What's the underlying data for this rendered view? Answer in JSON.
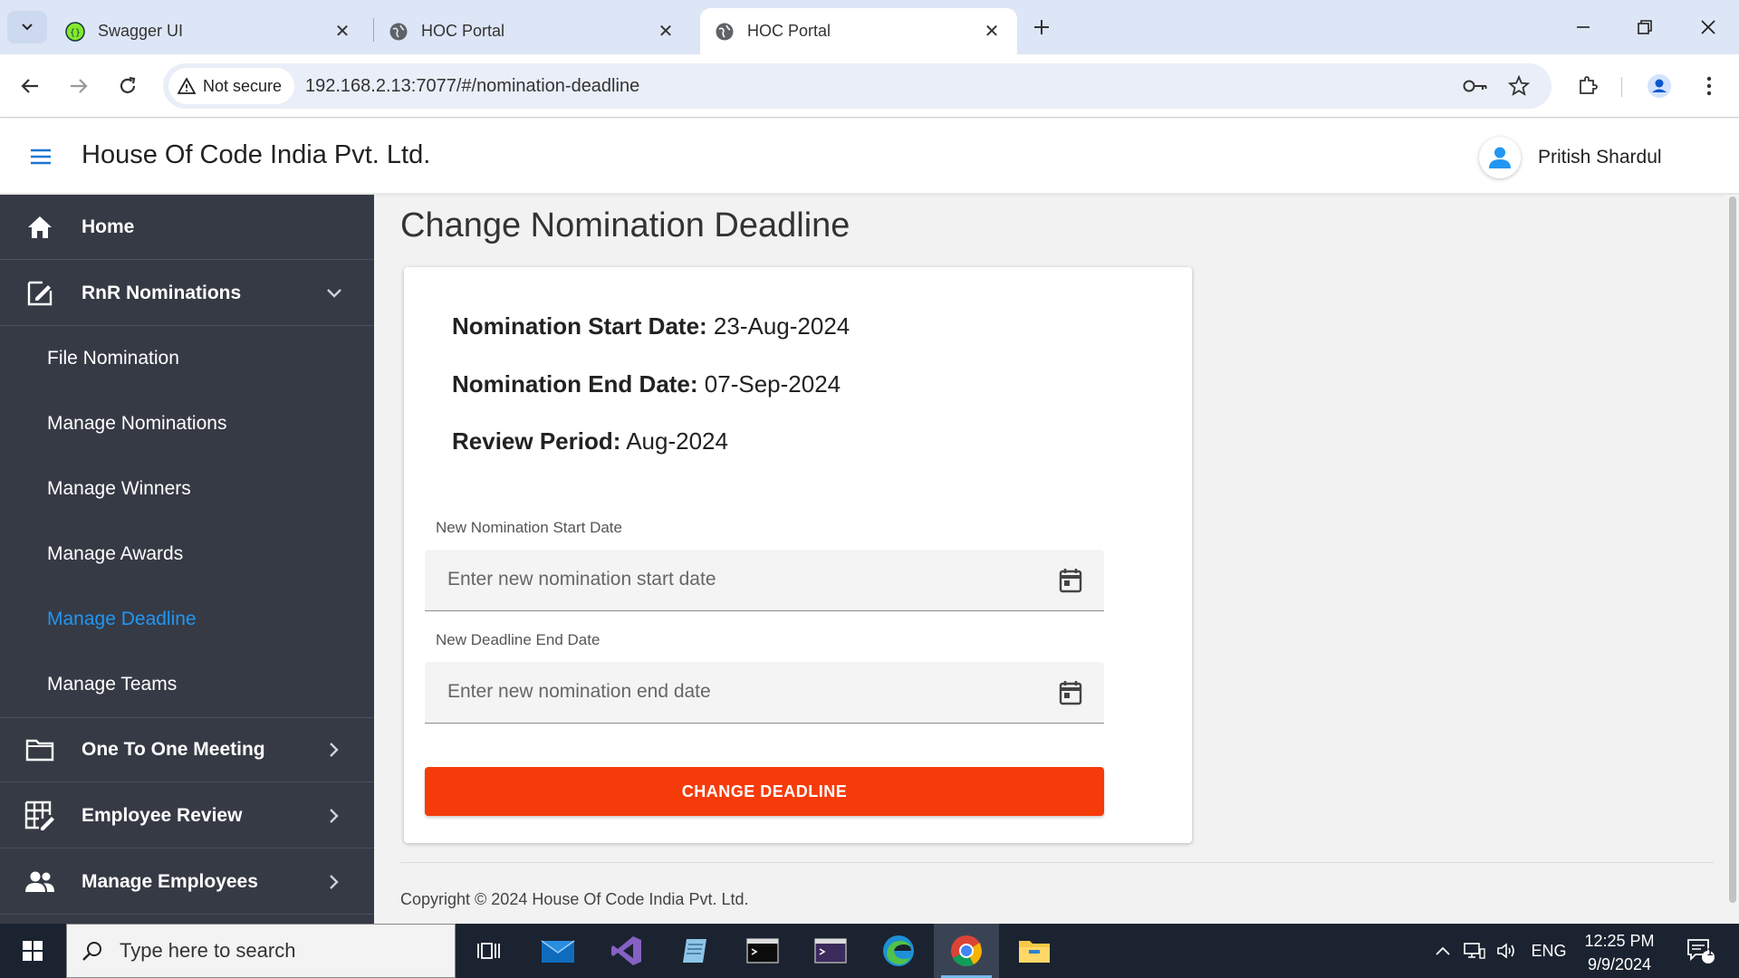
{
  "browser": {
    "tabs": [
      {
        "title": "Swagger UI",
        "favicon": "swagger-icon",
        "active": false
      },
      {
        "title": "HOC Portal",
        "favicon": "globe-icon",
        "active": false
      },
      {
        "title": "HOC Portal",
        "favicon": "globe-icon",
        "active": true
      }
    ],
    "security_label": "Not secure",
    "url": "192.168.2.13:7077/#/nomination-deadline"
  },
  "header": {
    "company": "House Of Code India Pvt. Ltd.",
    "user_name": "Pritish Shardul"
  },
  "sidebar": {
    "home": "Home",
    "rnr": "RnR Nominations",
    "sub_items": [
      {
        "label": "File Nomination",
        "active": false
      },
      {
        "label": "Manage Nominations",
        "active": false
      },
      {
        "label": "Manage Winners",
        "active": false
      },
      {
        "label": "Manage Awards",
        "active": false
      },
      {
        "label": "Manage Deadline",
        "active": true
      },
      {
        "label": "Manage Teams",
        "active": false
      }
    ],
    "one_to_one": "One To One Meeting",
    "employee_review": "Employee Review",
    "manage_employees": "Manage Employees",
    "active_color": "#2196f3",
    "background": "#363a45"
  },
  "page": {
    "title": "Change Nomination Deadline",
    "start_date_label": "Nomination Start Date:",
    "start_date_value": "23-Aug-2024",
    "end_date_label": "Nomination End Date:",
    "end_date_value": "07-Sep-2024",
    "review_label": "Review Period:",
    "review_value": "Aug-2024",
    "new_start_label": "New Nomination Start Date",
    "new_start_placeholder": "Enter new nomination start date",
    "new_end_label": "New Deadline End Date",
    "new_end_placeholder": "Enter new nomination end date",
    "submit_label": "CHANGE DEADLINE",
    "submit_color": "#f63b0b"
  },
  "footer": {
    "copyright": "Copyright © 2024 House Of Code India Pvt. Ltd."
  },
  "taskbar": {
    "search_placeholder": "Type here to search",
    "language": "ENG",
    "time": "12:25 PM",
    "date": "9/9/2024",
    "notification_count": "1"
  }
}
